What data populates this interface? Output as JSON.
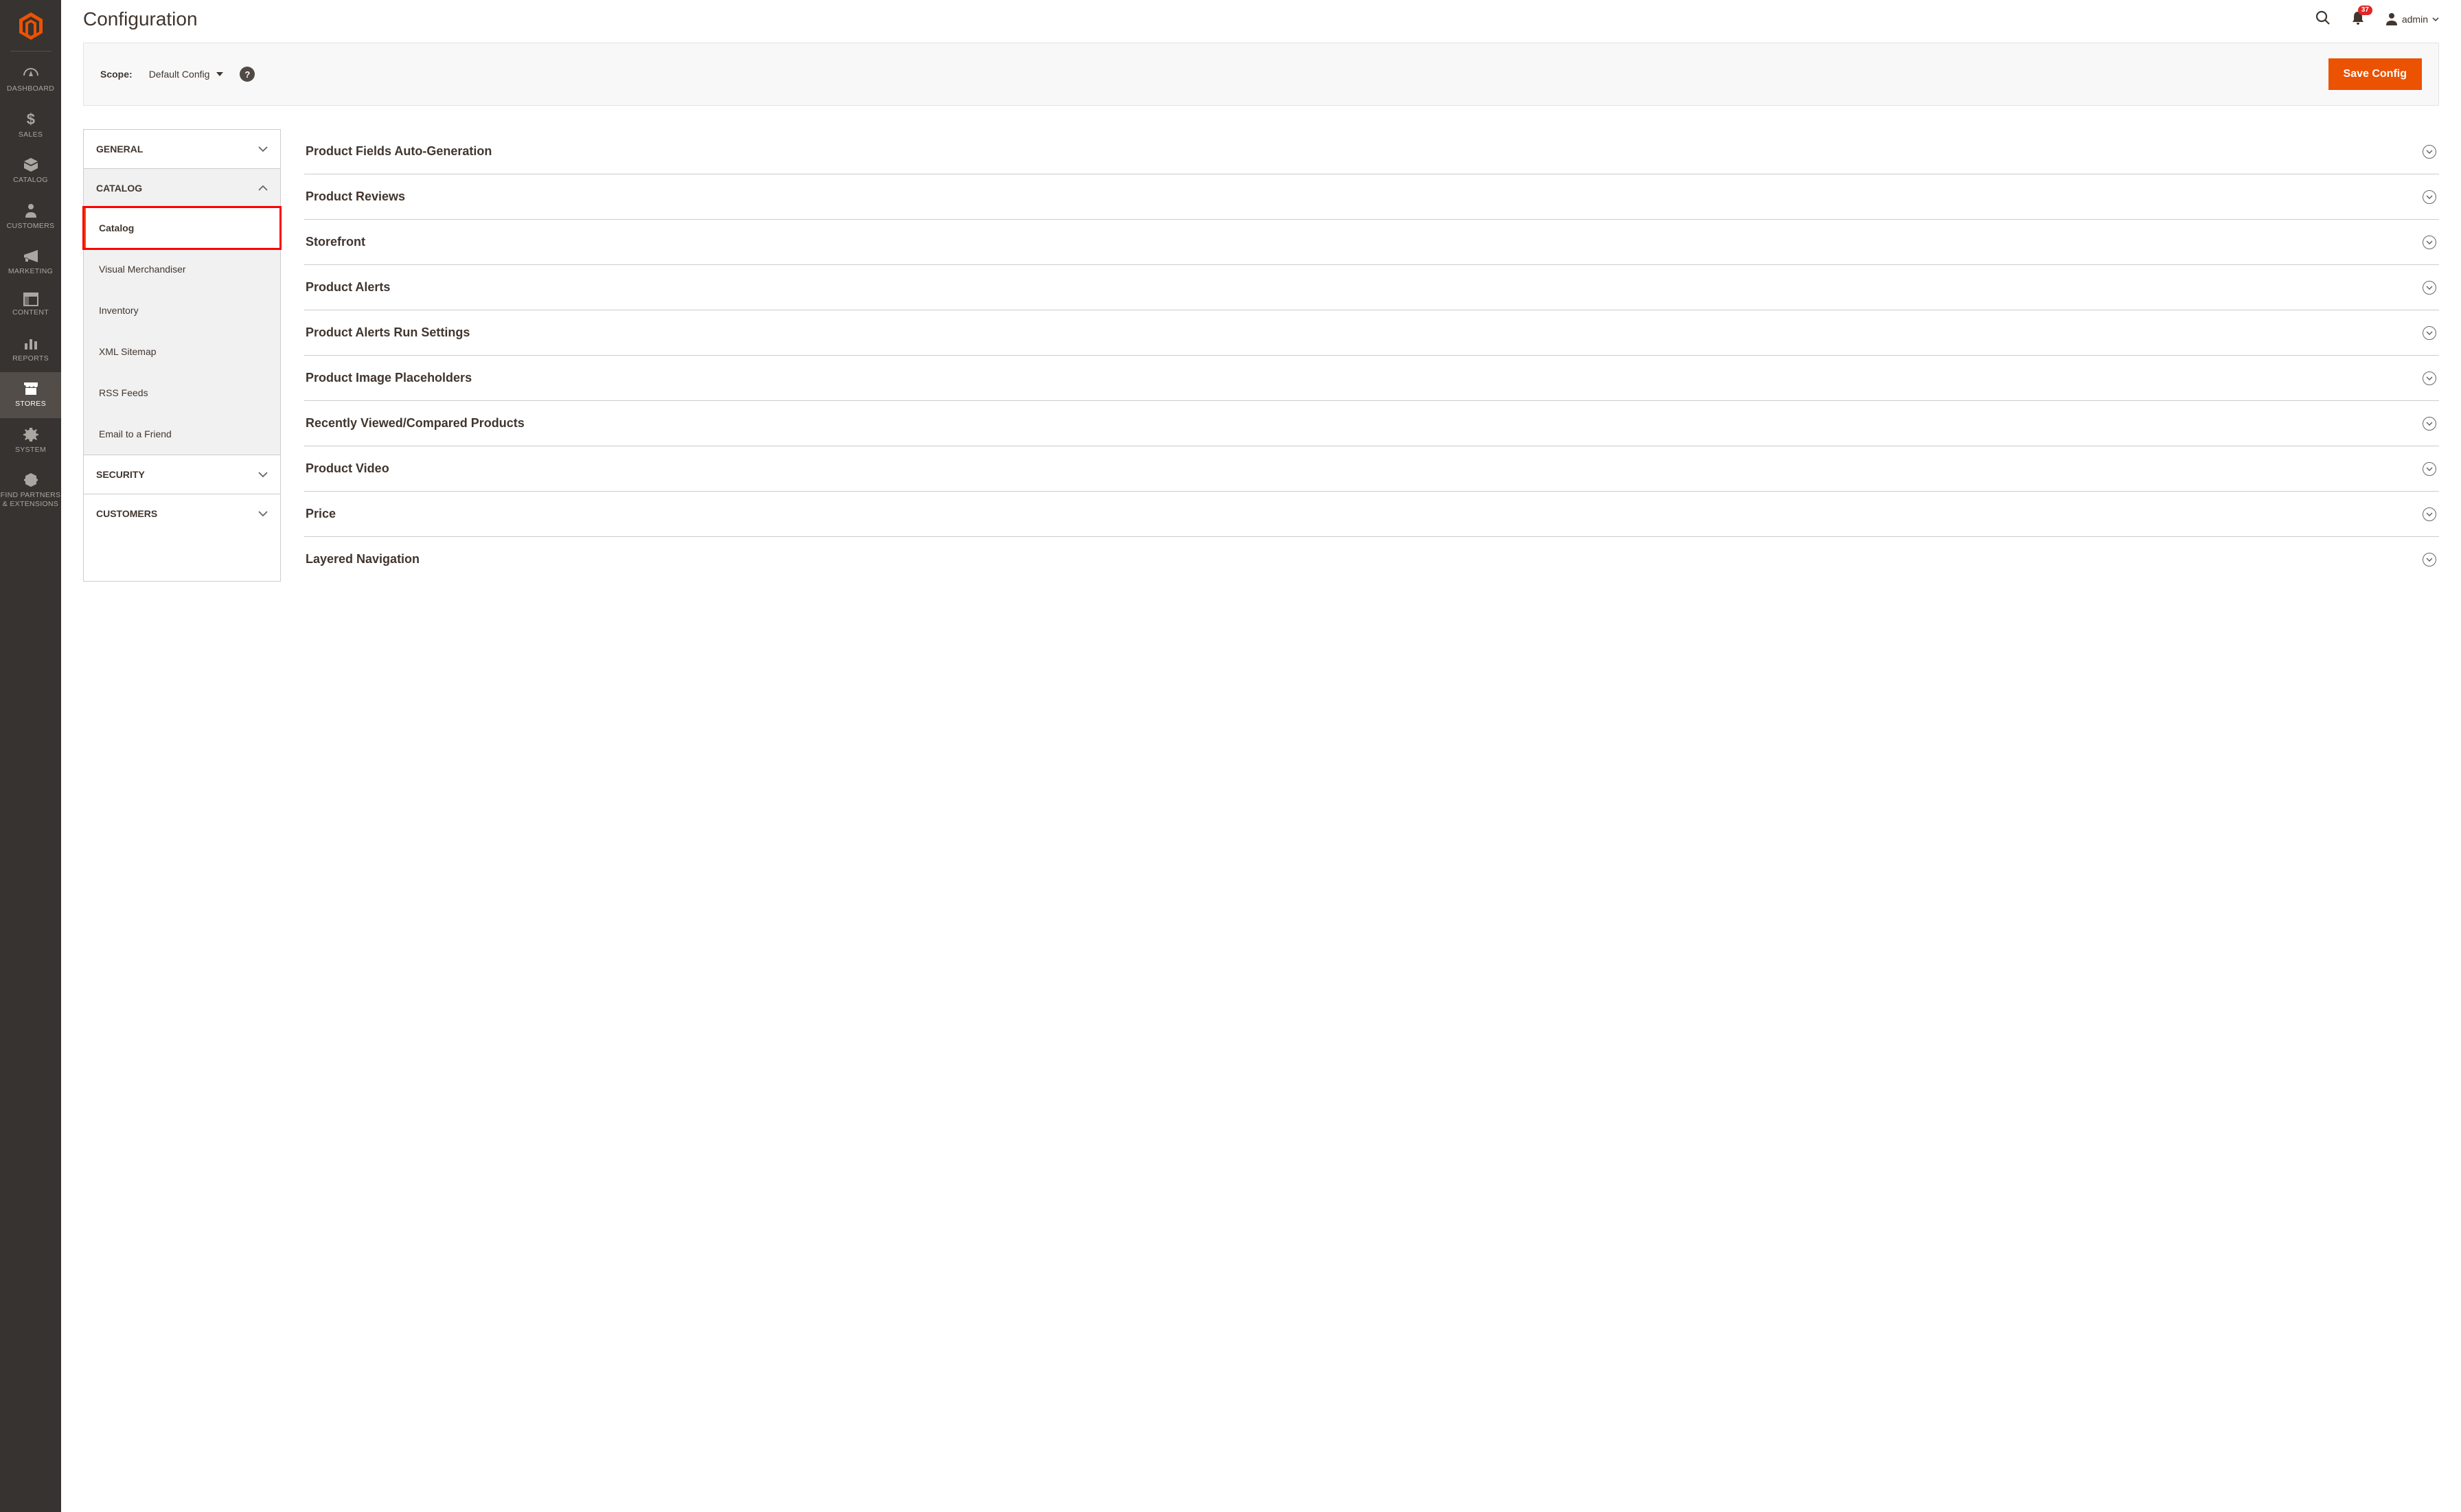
{
  "header": {
    "title": "Configuration",
    "notification_count": "37",
    "username": "admin"
  },
  "scope": {
    "label": "Scope:",
    "value": "Default Config",
    "save_button": "Save Config"
  },
  "sidebar": {
    "items": [
      {
        "label": "DASHBOARD"
      },
      {
        "label": "SALES"
      },
      {
        "label": "CATALOG"
      },
      {
        "label": "CUSTOMERS"
      },
      {
        "label": "MARKETING"
      },
      {
        "label": "CONTENT"
      },
      {
        "label": "REPORTS"
      },
      {
        "label": "STORES"
      },
      {
        "label": "SYSTEM"
      },
      {
        "label": "FIND PARTNERS & EXTENSIONS"
      }
    ]
  },
  "config_nav": {
    "sections": [
      {
        "label": "GENERAL"
      },
      {
        "label": "CATALOG",
        "items": [
          {
            "label": "Catalog"
          },
          {
            "label": "Visual Merchandiser"
          },
          {
            "label": "Inventory"
          },
          {
            "label": "XML Sitemap"
          },
          {
            "label": "RSS Feeds"
          },
          {
            "label": "Email to a Friend"
          }
        ]
      },
      {
        "label": "SECURITY"
      },
      {
        "label": "CUSTOMERS"
      }
    ]
  },
  "panels": [
    {
      "title": "Product Fields Auto-Generation"
    },
    {
      "title": "Product Reviews"
    },
    {
      "title": "Storefront"
    },
    {
      "title": "Product Alerts"
    },
    {
      "title": "Product Alerts Run Settings"
    },
    {
      "title": "Product Image Placeholders"
    },
    {
      "title": "Recently Viewed/Compared Products"
    },
    {
      "title": "Product Video"
    },
    {
      "title": "Price"
    },
    {
      "title": "Layered Navigation"
    }
  ]
}
